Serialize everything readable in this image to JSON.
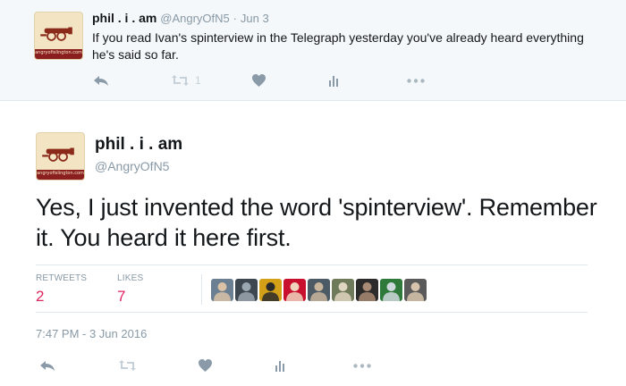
{
  "parent_tweet": {
    "name": "phil . i . am",
    "handle": "@AngryOfN5",
    "date": "Jun 3",
    "separator": "·",
    "text": "If you read Ivan's spinterview in the Telegraph yesterday you've already heard everything he's said so far.",
    "retweet_count": "1",
    "avatar_caption": "angryofislington.com"
  },
  "main_tweet": {
    "name": "phil . i . am",
    "handle": "@AngryOfN5",
    "text": "Yes, I just invented the word 'spinterview'. Remember it. You heard it here first.",
    "retweets_label": "RETWEETS",
    "retweets_value": "2",
    "likes_label": "LIKES",
    "likes_value": "7",
    "timestamp": "7:47 PM - 3 Jun 2016",
    "avatar_caption": "angryofislington.com"
  },
  "likers": [
    {
      "name": "liker-1",
      "bg": "#6a7f92",
      "fg": "#d9c2a6"
    },
    {
      "name": "liker-2",
      "bg": "#3d4750",
      "fg": "#9aa6b0"
    },
    {
      "name": "liker-3",
      "bg": "#d4a017",
      "fg": "#2a2a2a"
    },
    {
      "name": "liker-4",
      "bg": "#c8102e",
      "fg": "#f0d4c0"
    },
    {
      "name": "liker-5",
      "bg": "#4c5a66",
      "fg": "#c9b59c"
    },
    {
      "name": "liker-6",
      "bg": "#6f7a5a",
      "fg": "#e0d5c0"
    },
    {
      "name": "liker-7",
      "bg": "#2b2b2b",
      "fg": "#a98a74"
    },
    {
      "name": "liker-8",
      "bg": "#2f7a3a",
      "fg": "#cfd8dc"
    },
    {
      "name": "liker-9",
      "bg": "#5a5a5a",
      "fg": "#d8c4ad"
    }
  ],
  "colors": {
    "link_blue": "#1b5b9b",
    "retweet_red": "#e0245e",
    "muted": "#8899a6",
    "icon": "#aab8c2"
  }
}
